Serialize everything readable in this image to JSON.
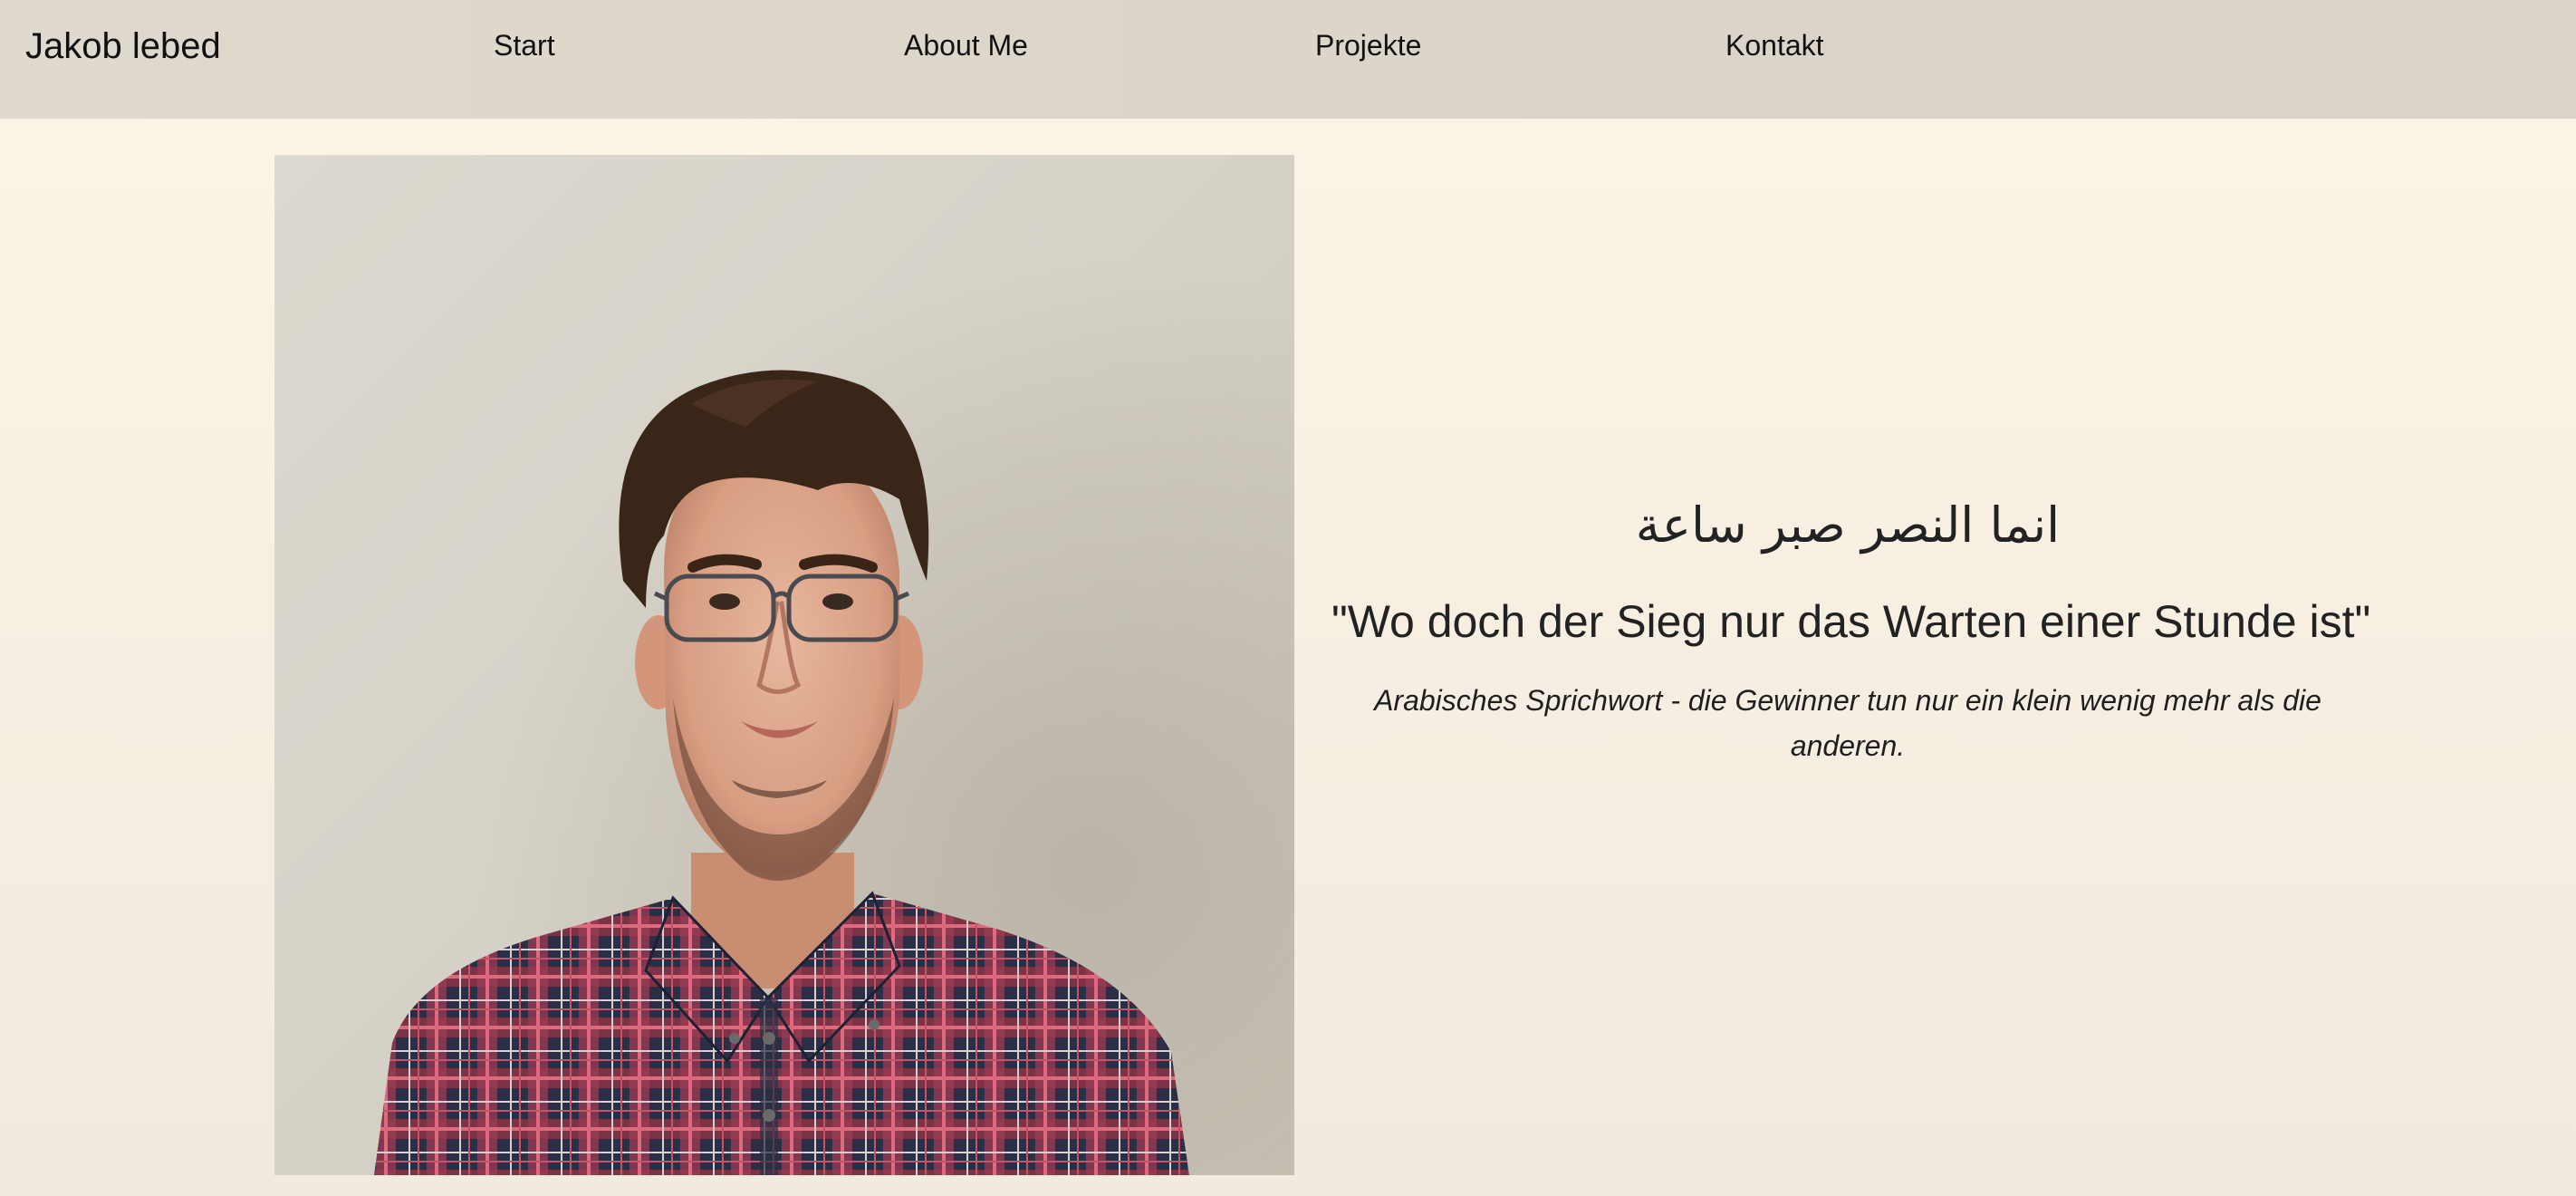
{
  "nav": {
    "brand": "Jakob lebed",
    "links": [
      {
        "label": "Start"
      },
      {
        "label": "About Me"
      },
      {
        "label": "Projekte"
      },
      {
        "label": "Kontakt"
      }
    ]
  },
  "hero": {
    "arabic_quote": "انما النصر صبر ساعة",
    "german_quote": "\"Wo doch der Sieg nur das Warten einer Stunde ist\"",
    "caption": "Arabisches Sprichwort - die Gewinner tun nur ein klein wenig mehr als die anderen."
  },
  "colors": {
    "nav_background": "#dcd5ca",
    "page_background": "#f7efe2",
    "text": "#222222"
  }
}
